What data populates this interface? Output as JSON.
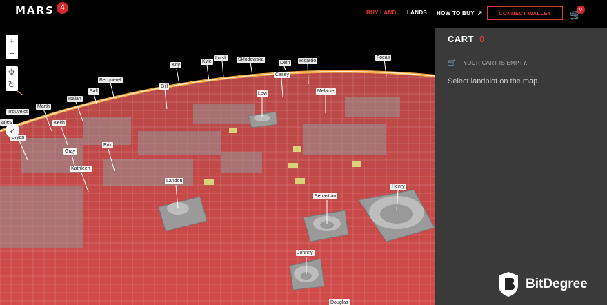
{
  "header": {
    "logo_text": "MARS",
    "logo_badge": "4",
    "nav": {
      "buy_land": "BUY LAND",
      "lands": "LANDS",
      "how_to_buy": "HOW TO BUY"
    },
    "connect_wallet": "CONNECT WALLET",
    "cart_badge": "0"
  },
  "map": {
    "labels": [
      {
        "text": "Koy"
      },
      {
        "text": "Kyle"
      },
      {
        "text": "Lutsk"
      },
      {
        "text": "Skłodowska"
      },
      {
        "text": "Dein"
      },
      {
        "text": "Ricardo"
      },
      {
        "text": "Focas"
      },
      {
        "text": "Casey"
      },
      {
        "text": "Becquerel"
      },
      {
        "text": "Gill"
      },
      {
        "text": "Salt"
      },
      {
        "text": "Levi"
      },
      {
        "text": "Melanie"
      },
      {
        "text": "Isaiah"
      },
      {
        "text": "Marth"
      },
      {
        "text": "Trouvelot"
      },
      {
        "text": "anes"
      },
      {
        "text": "Keith"
      },
      {
        "text": "Bryan"
      },
      {
        "text": "Erik"
      },
      {
        "text": "Gray"
      },
      {
        "text": "Kathleen"
      },
      {
        "text": "Landon"
      },
      {
        "text": "Henry"
      },
      {
        "text": "Sebastian"
      },
      {
        "text": "Johnny"
      },
      {
        "text": "Douglas"
      }
    ],
    "zoom_in": "+",
    "zoom_out": "−"
  },
  "cart": {
    "title": "CART",
    "count": "0",
    "empty_text": "YOUR CART IS EMPTY.",
    "hint": "Select landplot on the map."
  },
  "watermark": {
    "text": "BitDegree"
  },
  "colors": {
    "accent": "#e23a3a",
    "panel_bg": "#3a3a3a",
    "surface": "#c94545"
  }
}
